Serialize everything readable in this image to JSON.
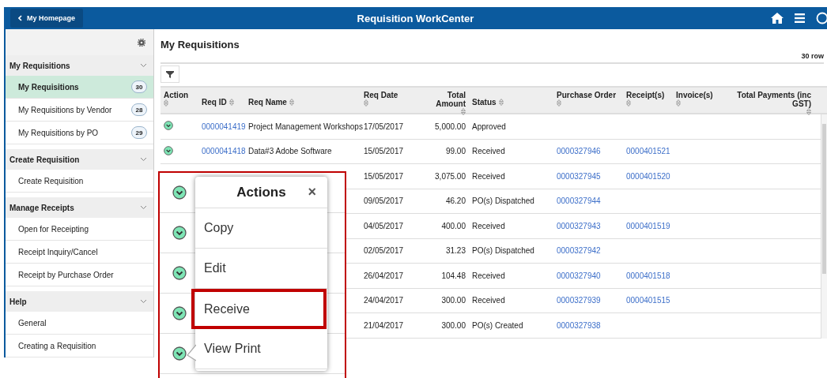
{
  "header": {
    "back_button": "My Homepage",
    "title": "Requisition WorkCenter"
  },
  "sidebar": {
    "groups": [
      {
        "title": "My Requisitions",
        "items": [
          {
            "label": "My Requisitions",
            "count": "30",
            "selected": true
          },
          {
            "label": "My Requisitions by Vendor",
            "count": "28",
            "selected": false
          },
          {
            "label": "My Requisitions by PO",
            "count": "29",
            "selected": false
          }
        ]
      },
      {
        "title": "Create Requisition",
        "items": [
          {
            "label": "Create Requisition",
            "selected": false
          }
        ]
      },
      {
        "title": "Manage Receipts",
        "items": [
          {
            "label": "Open for Receipting",
            "selected": false
          },
          {
            "label": "Receipt Inquiry/Cancel",
            "selected": false
          },
          {
            "label": "Receipt by Purchase Order",
            "selected": false
          }
        ]
      },
      {
        "title": "Help",
        "items": [
          {
            "label": "General",
            "selected": false
          },
          {
            "label": "Creating a Requisition",
            "selected": false
          }
        ]
      }
    ]
  },
  "main": {
    "title": "My Requisitions",
    "row_count": "30 row"
  },
  "table": {
    "columns": [
      "Action",
      "Req ID",
      "Req Name",
      "Req Date",
      "Total Amount",
      "Status",
      "Purchase Order",
      "Receipt(s)",
      "Invoice(s)",
      "Total Payments (inc GST)"
    ],
    "rows": [
      {
        "req_id": "0000041419",
        "req_name": "Project Management Workshops",
        "req_date": "17/05/2017",
        "total_amount": "5,000.00",
        "status": "Approved"
      },
      {
        "req_id": "0000041418",
        "req_name": "Data#3 Adobe Software",
        "req_date": "15/05/2017",
        "total_amount": "99.00",
        "status": "Received",
        "purchase_order": "0000327946",
        "receipt": "0000401521"
      },
      {
        "req_date": "15/05/2017",
        "total_amount": "3,075.00",
        "status": "Received",
        "purchase_order": "0000327945",
        "receipt": "0000401520"
      },
      {
        "req_date": "09/05/2017",
        "total_amount": "46.20",
        "status": "PO(s) Dispatched",
        "purchase_order": "0000327944"
      },
      {
        "req_date": "04/05/2017",
        "total_amount": "400.00",
        "status": "Received",
        "purchase_order": "0000327943",
        "receipt": "0000401519"
      },
      {
        "req_date": "02/05/2017",
        "total_amount": "31.23",
        "status": "PO(s) Dispatched",
        "purchase_order": "0000327942"
      },
      {
        "req_date": "26/04/2017",
        "total_amount": "104.48",
        "status": "Received",
        "purchase_order": "0000327940",
        "receipt": "0000401518"
      },
      {
        "req_date": "24/04/2017",
        "total_amount": "300.00",
        "status": "Received",
        "purchase_order": "0000327939",
        "receipt": "0000401515"
      },
      {
        "req_date": "21/04/2017",
        "total_amount": "300.00",
        "status": "PO(s) Created",
        "purchase_order": "0000327938"
      }
    ]
  },
  "actions_menu": {
    "title": "Actions",
    "close": "×",
    "items": [
      {
        "label": "Copy",
        "selected": false
      },
      {
        "label": "Edit",
        "selected": false
      },
      {
        "label": "Receive",
        "selected": true
      },
      {
        "label": "View Print",
        "selected": false
      }
    ]
  }
}
